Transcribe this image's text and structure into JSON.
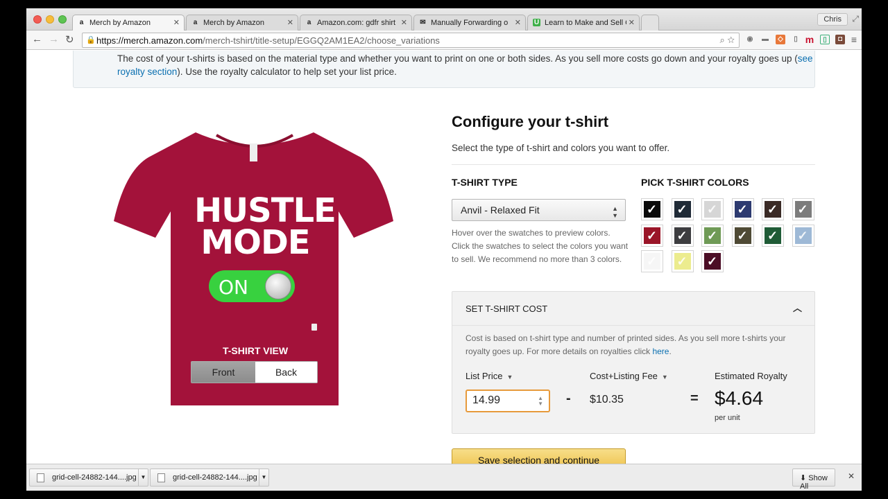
{
  "browser": {
    "tabs": [
      {
        "title": "Merch by Amazon",
        "favicon": "a"
      },
      {
        "title": "Merch by Amazon",
        "favicon": "a"
      },
      {
        "title": "Amazon.com: gdfr shirt",
        "favicon": "a"
      },
      {
        "title": "Manually Forwarding or M",
        "favicon": "✉"
      },
      {
        "title": "Learn to Make and Sell Cu",
        "favicon": "U"
      }
    ],
    "profile": "Chris",
    "url_host": "https://merch.amazon.com",
    "url_path": "/merch-tshirt/title-setup/EGGQ2AM1EA2/choose_variations"
  },
  "notice": {
    "text_before": "The cost of your t-shirts is based on the material type and whether you want to print on one or both sides. As you sell more costs go down and your royalty goes up (",
    "link": "see royalty section",
    "text_after": "). Use the royalty calculator to help set your list price."
  },
  "preview": {
    "print_line1": "HUSTLE",
    "print_line2": "MODE",
    "toggle_text": "ON",
    "view_label": "T-SHIRT VIEW",
    "front": "Front",
    "back": "Back",
    "shirt_color": "#a3123a"
  },
  "config": {
    "title": "Configure your t-shirt",
    "subtitle": "Select the type of t-shirt and colors you want to offer.",
    "type_label": "T-SHIRT TYPE",
    "type_value": "Anvil - Relaxed Fit",
    "hint": "Hover over the swatches to preview colors. Click the swatches to select the colors you want to sell. We recommend no more than 3 colors.",
    "colors_label": "PICK T-SHIRT COLORS",
    "swatches": [
      "#0a0a0a",
      "#1f2a36",
      "#d6d6d6",
      "#2d3a70",
      "#3a2a25",
      "#7c7c7c",
      "#9a1528",
      "#3d3d40",
      "#6f9a56",
      "#4f4a35",
      "#1f5b36",
      "#9eb9d6",
      "#f6f6f6",
      "#ecec8e",
      "#4c0e26"
    ]
  },
  "cost": {
    "title": "SET T-SHIRT COST",
    "desc_before": "Cost is based on t-shirt type and number of printed sides. As you sell more t-shirts your royalty goes up. For more details on royalties click ",
    "desc_link": "here",
    "desc_after": ".",
    "list_price_label": "List Price",
    "list_price_value": "14.99",
    "fee_label": "Cost+Listing Fee",
    "fee_value": "$10.35",
    "royalty_label": "Estimated Royalty",
    "royalty_value": "$4.64",
    "per_unit": "per unit",
    "minus": "-",
    "equals": "="
  },
  "save_button": "Save selection and continue",
  "downloads": {
    "items": [
      "grid-cell-24882-144....jpg",
      "grid-cell-24882-144....jpg"
    ],
    "show_all": "Show All"
  }
}
